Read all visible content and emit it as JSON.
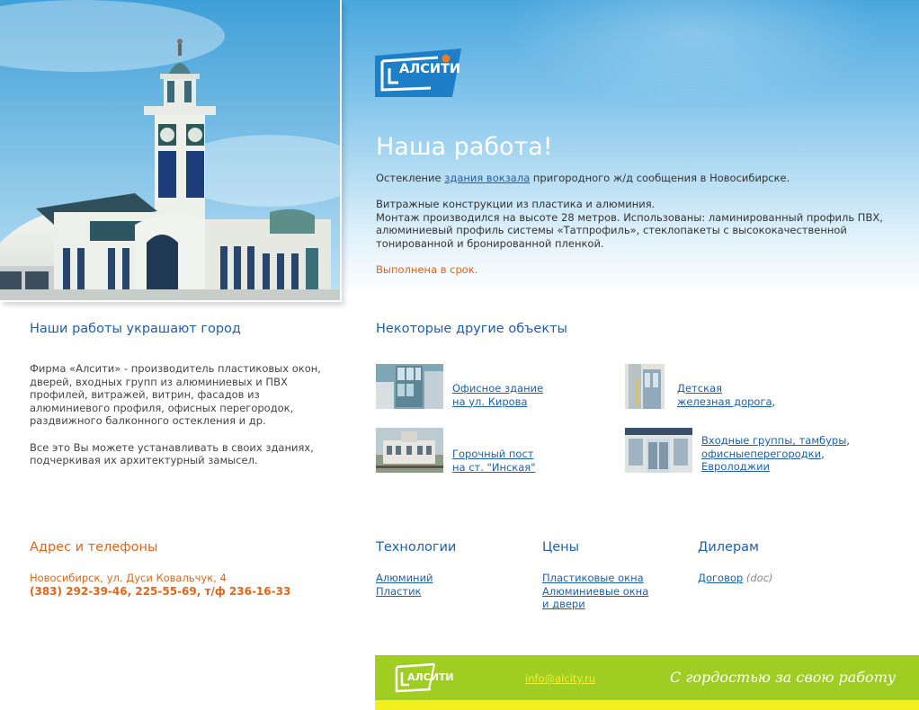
{
  "brand": {
    "name": "АЛСИТИ"
  },
  "hero": {
    "title": "Наша работа!",
    "line1_pre": "Остекление ",
    "line1_link": "здания вокзала",
    "line1_post": " пригородного ж/д сообщения в Новосибирске.",
    "line2": "Витражные конструкции из пластика и алюминия.",
    "line3": "Монтаж производился на высоте 28 метров. Использованы: ламинированный профиль ПВХ, алюминиевый профиль системы «Татпрофиль», стеклопакеты с высококачественной тонированной и бронированной пленкой.",
    "done": "Выполнена в срок."
  },
  "about": {
    "title": "Наши работы украшают город",
    "p1": "Фирма «Алсити» - производитель пластиковых окон, дверей, входных групп из алюминиевых и ПВХ профилей, витражей, витрин, фасадов из алюминиевого профиля, офисных перегородок, раздвижного балконного остекления и др.",
    "p2": "Все это Вы можете устанавливать в своих зданиях, подчеркивая их архитектурный замысел."
  },
  "objects": {
    "title": "Некоторые другие объекты",
    "items": [
      {
        "lines": [
          "Офисное здание",
          "на ул. Кирова"
        ]
      },
      {
        "lines": [
          "Детская",
          "железная дорога"
        ],
        "suffix": ","
      },
      {
        "lines": [
          "Горочный пост",
          "на ст. \"Инская\""
        ]
      },
      {
        "lines": [
          "Входные группы, тамбуры",
          "офисныеперегородки",
          "Евролоджии"
        ],
        "suffixes": [
          ",",
          ",",
          ""
        ]
      }
    ]
  },
  "contacts": {
    "title": "Адрес и телефоны",
    "address": "Новосибирск, ул. Дуси Ковальчук, 4",
    "phones": "(383) 292-39-46, 225-55-69, т/ф 236-16-33"
  },
  "technologies": {
    "title": "Технологии",
    "links": [
      "Алюминий",
      "Пластик"
    ]
  },
  "prices": {
    "title": "Цены",
    "links": [
      "Пластиковые окна",
      "Алюминиевые окна",
      "и двери"
    ]
  },
  "dealers": {
    "title": "Дилерам",
    "link": "Договор",
    "note": " (doc)"
  },
  "footer": {
    "email": "info@alcity.ru",
    "slogan": "С гордостью за свою работу"
  },
  "colors": {
    "accent": "#1f5fa8",
    "logo_blue": "#1c7fc8",
    "orange": "#e0651a",
    "footer_green": "#9fcd22",
    "footer_yellow": "#f3ee1e"
  }
}
